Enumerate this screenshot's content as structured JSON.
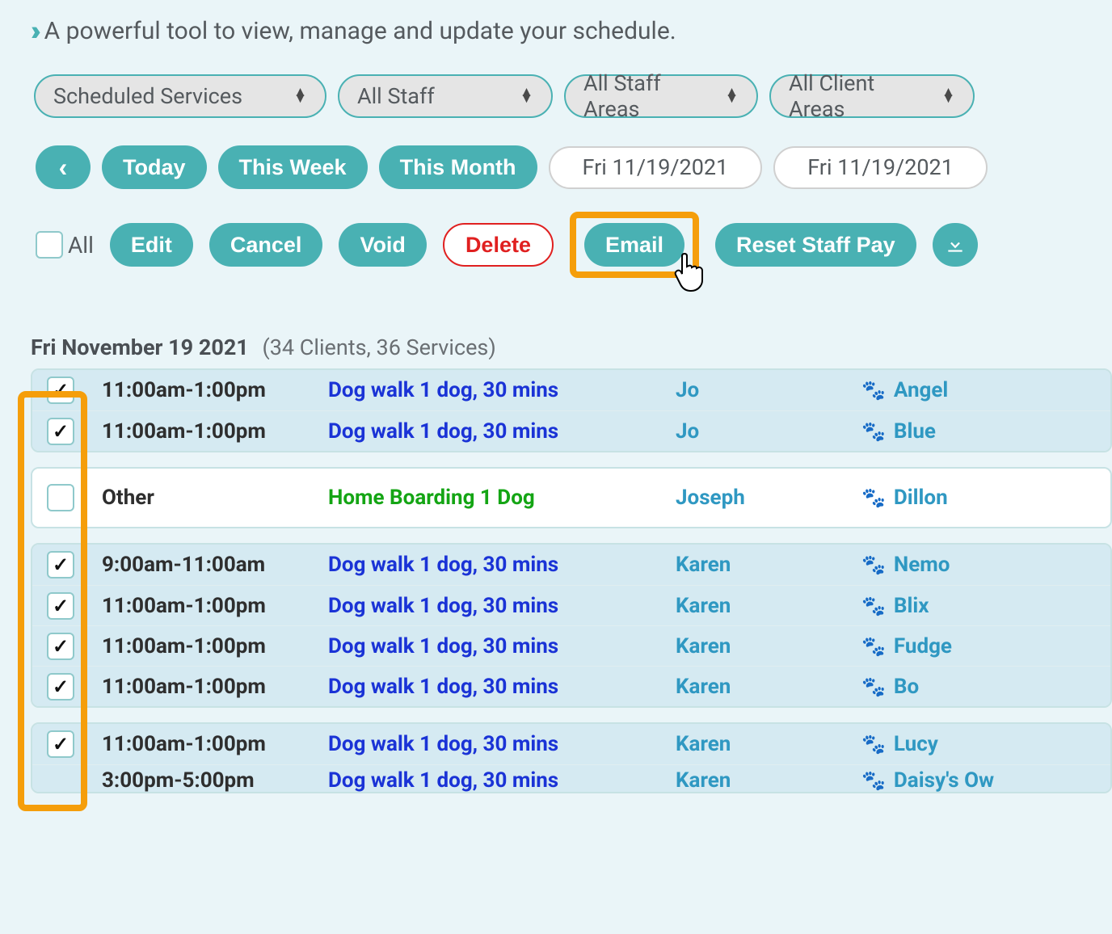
{
  "tagline": "A powerful tool to view, manage and update your schedule.",
  "filters": {
    "services": "Scheduled Services",
    "staff": "All Staff",
    "staff_areas": "All Staff Areas",
    "client_areas": "All Client Areas"
  },
  "nav": {
    "today": "Today",
    "this_week": "This Week",
    "this_month": "This Month",
    "date_from": "Fri 11/19/2021",
    "date_to": "Fri 11/19/2021"
  },
  "actions": {
    "all_label": "All",
    "edit": "Edit",
    "cancel": "Cancel",
    "void": "Void",
    "delete": "Delete",
    "email": "Email",
    "reset_staff_pay": "Reset Staff Pay"
  },
  "day": {
    "label": "Fri November 19 2021",
    "meta": "(34 Clients, 36 Services)"
  },
  "rows": [
    {
      "checked": true,
      "group": 0,
      "bg": "blue",
      "time": "11:00am-1:00pm",
      "svc": "Dog walk 1 dog, 30 mins",
      "svc_style": "blue",
      "staff": "Jo",
      "pet": "Angel"
    },
    {
      "checked": true,
      "group": 0,
      "bg": "blue",
      "time": "11:00am-1:00pm",
      "svc": "Dog walk 1 dog, 30 mins",
      "svc_style": "blue",
      "staff": "Jo",
      "pet": "Blue"
    },
    {
      "checked": false,
      "group": 1,
      "bg": "white",
      "time": "Other",
      "svc": "Home Boarding 1 Dog",
      "svc_style": "green",
      "staff": "Joseph",
      "pet": "Dillon",
      "big": true
    },
    {
      "checked": true,
      "group": 2,
      "bg": "blue",
      "time": "9:00am-11:00am",
      "svc": "Dog walk 1 dog, 30 mins",
      "svc_style": "blue",
      "staff": "Karen",
      "pet": "Nemo"
    },
    {
      "checked": true,
      "group": 2,
      "bg": "blue",
      "time": "11:00am-1:00pm",
      "svc": "Dog walk 1 dog, 30 mins",
      "svc_style": "blue",
      "staff": "Karen",
      "pet": "Blix"
    },
    {
      "checked": true,
      "group": 2,
      "bg": "blue",
      "time": "11:00am-1:00pm",
      "svc": "Dog walk 1 dog, 30 mins",
      "svc_style": "blue",
      "staff": "Karen",
      "pet": "Fudge"
    },
    {
      "checked": true,
      "group": 2,
      "bg": "blue",
      "time": "11:00am-1:00pm",
      "svc": "Dog walk 1 dog, 30 mins",
      "svc_style": "blue",
      "staff": "Karen",
      "pet": "Bo"
    },
    {
      "checked": true,
      "group": 3,
      "bg": "blue",
      "time": "11:00am-1:00pm",
      "svc": "Dog walk 1 dog, 30 mins",
      "svc_style": "blue",
      "staff": "Karen",
      "pet": "Lucy"
    },
    {
      "checked": false,
      "group": 3,
      "bg": "blue",
      "time": "3:00pm-5:00pm",
      "svc": "Dog walk 1 dog, 30 mins",
      "svc_style": "blue",
      "staff": "Karen",
      "pet": "Daisy's Ow",
      "partial": true
    }
  ]
}
